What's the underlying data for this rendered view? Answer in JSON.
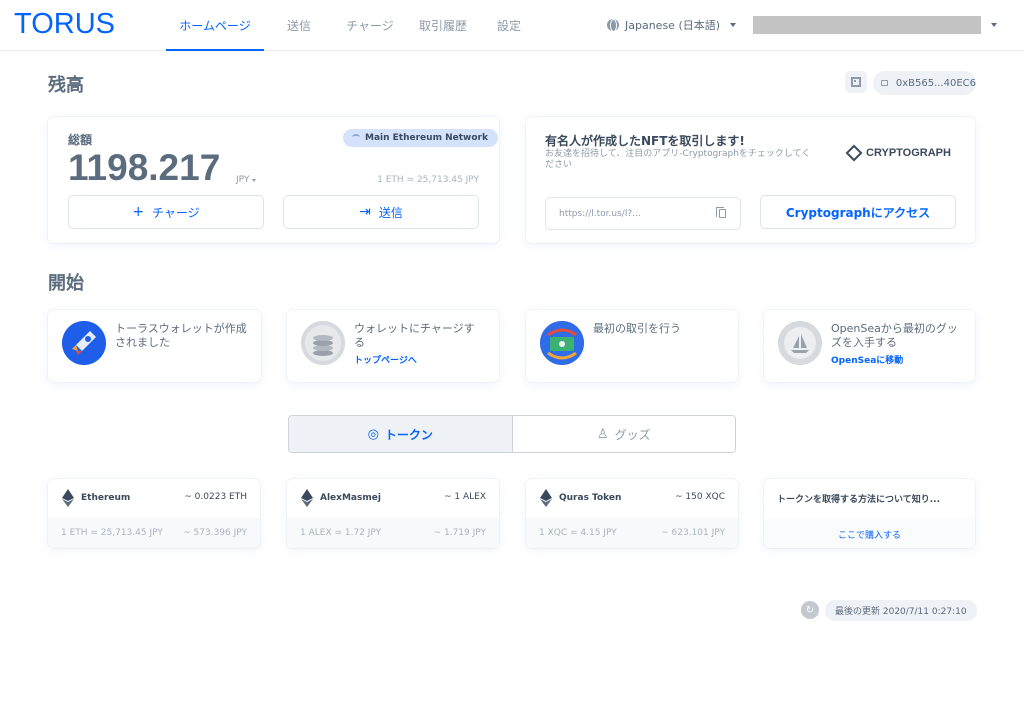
{
  "brand": {
    "logo_text": "TORUS",
    "accent": "#0364ff"
  },
  "nav": {
    "items": [
      {
        "label": "ホームページ",
        "active": true
      },
      {
        "label": "送信",
        "active": false
      },
      {
        "label": "チャージ",
        "active": false
      },
      {
        "label": "取引履歴",
        "active": false
      },
      {
        "label": "設定",
        "active": false
      }
    ]
  },
  "language": {
    "selected": "Japanese (日本語)"
  },
  "balance_section": {
    "title": "残高",
    "address": "0xB565...40EC6",
    "total_label": "総額",
    "network": "Main Ethereum Network",
    "amount": "1198.217",
    "currency": "JPY",
    "rate": "1 ETH = 25,713.45 JPY",
    "charge_label": "チャージ",
    "send_label": "送信"
  },
  "promo": {
    "title": "有名人が作成したNFTを取引します!",
    "description": "お友達を招待して、注目のアプリ-Cryptographをチェックしてください",
    "logo_text": "CRYPTOGRAPH",
    "link": "https://l.tor.us/l?...",
    "access_button_label": "Cryptographにアクセス"
  },
  "start_section": {
    "title": "開始",
    "tiles": [
      {
        "title": "トーラスウォレットが作成されました",
        "link": ""
      },
      {
        "title": "ウォレットにチャージする",
        "link": "トップページへ"
      },
      {
        "title": "最初の取引を行う",
        "link": ""
      },
      {
        "title": "OpenSeaから最初のグッズを入手する",
        "link": "OpenSeaに移動"
      }
    ]
  },
  "tabs": [
    {
      "label": "トークン",
      "active": true,
      "icon": "token-icon"
    },
    {
      "label": "グッズ",
      "active": false,
      "icon": "collectibles-icon"
    }
  ],
  "tokens": [
    {
      "name": "Ethereum",
      "amount": "~ 0.0223 ETH",
      "rate": "1 ETH = 25,713.45 JPY",
      "value": "~ 573.396 JPY"
    },
    {
      "name": "AlexMasmej",
      "amount": "~ 1 ALEX",
      "rate": "1 ALEX = 1.72 JPY",
      "value": "~ 1.719 JPY"
    },
    {
      "name": "Quras Token",
      "amount": "~ 150 XQC",
      "rate": "1 XQC = 4.15 JPY",
      "value": "~ 623.101 JPY"
    }
  ],
  "buy_card": {
    "title": "トークンを取得する方法について知り...",
    "link": "ここで購入する"
  },
  "footer": {
    "last_updated": "最後の更新 2020/7/11 0:27:10"
  }
}
